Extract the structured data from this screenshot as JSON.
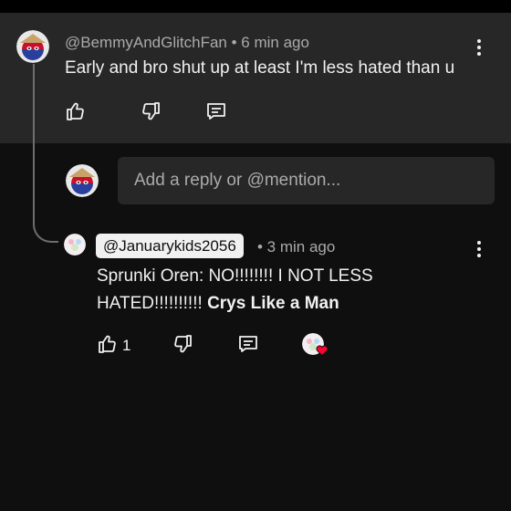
{
  "parent_comment": {
    "author": "@BemmyAndGlitchFan",
    "time": "• 6 min ago",
    "text": "Early and bro shut up at least I'm less hated than u",
    "avatar_icon": "ball-avatar-icon"
  },
  "reply_input": {
    "placeholder": "Add a reply or @mention..."
  },
  "reply_comment": {
    "mention": "@Januarykids2056",
    "time": "• 3 min ago",
    "text_plain": "Sprunki Oren: NO!!!!!!!! I NOT LESS HATED!!!!!!!!!! ",
    "text_bold": "Crys Like a Man",
    "like_count": "1",
    "creator_heart_color": "#ff0033"
  },
  "icons": [
    "like-icon",
    "dislike-icon",
    "reply-icon",
    "more-vert-icon",
    "creator-heart-icon"
  ],
  "colors": {
    "background": "#0f0f0f",
    "highlight": "#272727",
    "text": "#f1f1f1",
    "secondary_text": "#aaaaaa"
  }
}
